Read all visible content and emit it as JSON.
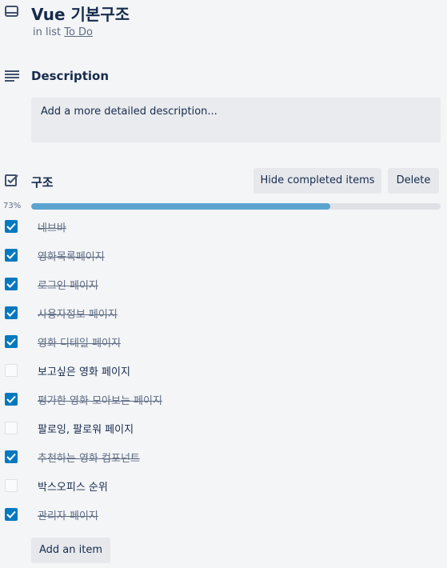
{
  "card": {
    "title": "Vue 기본구조",
    "in_list_prefix": "in list",
    "list_name": "To Do"
  },
  "description": {
    "title": "Description",
    "placeholder": "Add a more detailed description..."
  },
  "checklist": {
    "title": "구조",
    "hide_label": "Hide completed items",
    "delete_label": "Delete",
    "progress_label": "73%",
    "progress_value": 0.73,
    "add_label": "Add an item",
    "items": [
      {
        "label": "네브바",
        "checked": true
      },
      {
        "label": "영화목록페이지",
        "checked": true
      },
      {
        "label": "로그인 페이지",
        "checked": true
      },
      {
        "label": "사용자정보 페이지",
        "checked": true
      },
      {
        "label": "영화 디테일 페이지",
        "checked": true
      },
      {
        "label": "보고싶은 영화 페이지",
        "checked": false
      },
      {
        "label": "평가한 영화 모아보는 페이지",
        "checked": true
      },
      {
        "label": "팔로잉, 팔로워 페이지",
        "checked": false
      },
      {
        "label": "추천하는 영화 컴포넌트",
        "checked": true
      },
      {
        "label": "박스오피스 순위",
        "checked": false
      },
      {
        "label": "관리자 페이지",
        "checked": true
      }
    ]
  },
  "colors": {
    "checked": "#0079bf",
    "progress": "#5ba4cf"
  },
  "icons": [
    "card-icon",
    "description-icon",
    "checklist-icon",
    "checkmark-icon"
  ]
}
